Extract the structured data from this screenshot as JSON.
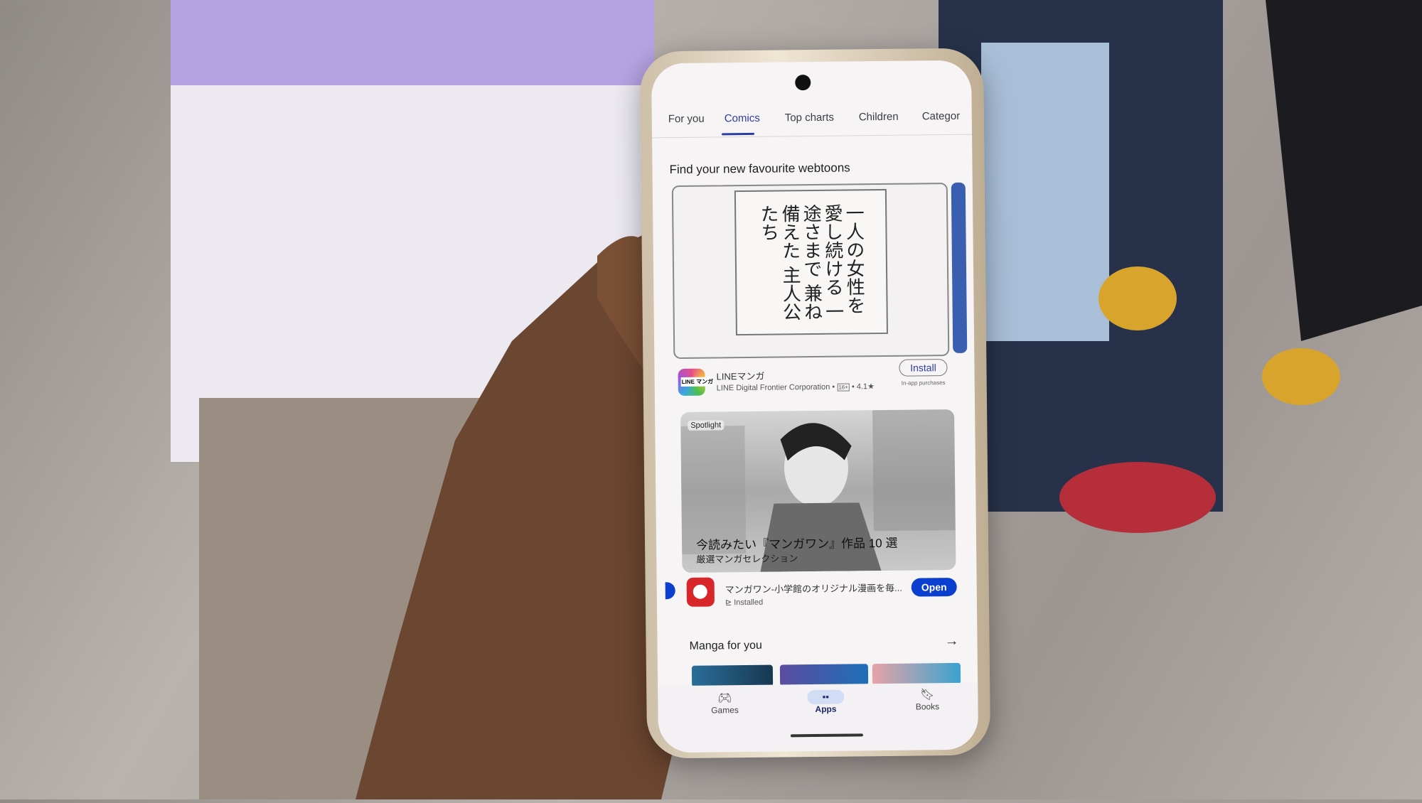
{
  "tabs": [
    {
      "label": "For you"
    },
    {
      "label": "Comics",
      "active": true
    },
    {
      "label": "Top charts"
    },
    {
      "label": "Children"
    },
    {
      "label": "Categor"
    }
  ],
  "section1": {
    "title": "Find your new favourite webtoons",
    "banner_text": "一人の女性を 愛し続ける 一途さまで 兼ね備えた 主人公たち",
    "app": {
      "name": "LINEマンガ",
      "developer": "LINE Digital Frontier Corporation",
      "age_rating": "16+",
      "rating": "4.1★",
      "button": "Install",
      "note": "In-app purchases",
      "icon_text": "LINE マンガ"
    }
  },
  "spotlight": {
    "badge": "Spotlight",
    "title": "今読みたい『マンガワン』作品 10 選",
    "subtitle": "厳選マンガセレクション",
    "app": {
      "name": "マンガワン-小学館のオリジナル漫画を毎...",
      "status": "Installed",
      "button": "Open"
    }
  },
  "section2": {
    "title": "Manga for you"
  },
  "bottom_nav": [
    {
      "label": "Games",
      "icon": "gamepad-icon"
    },
    {
      "label": "Apps",
      "icon": "apps-grid-icon",
      "active": true
    },
    {
      "label": "Books",
      "icon": "bookmark-icon"
    }
  ],
  "colors": {
    "accent": "#2c3da3",
    "open_button": "#0b3fcf"
  }
}
